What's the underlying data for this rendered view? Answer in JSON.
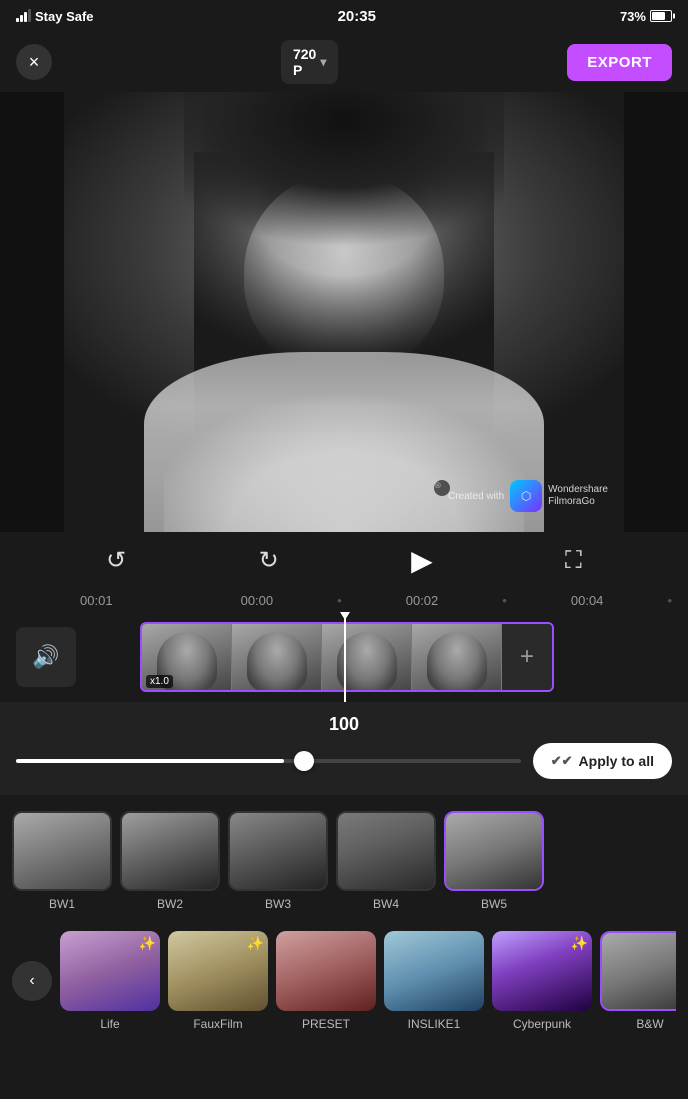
{
  "statusBar": {
    "carrier": "Stay Safe",
    "time": "20:35",
    "battery": "73%"
  },
  "toolbar": {
    "closeLabel": "×",
    "quality": "720\nP",
    "qualityDropdown": "▾",
    "exportLabel": "EXPORT"
  },
  "videoPreview": {
    "watermark": {
      "closeLabel": "×",
      "createdWith": "Created with",
      "appName": "Wondershare\nFilmoraGo"
    },
    "expandLabel": "⛶"
  },
  "playbackControls": {
    "undoIcon": "↺",
    "redoIcon": "↻",
    "playIcon": "▶",
    "fullscreenIcon": "⛶"
  },
  "timelineRuler": {
    "marks": [
      "00:01",
      "00:00",
      "•",
      "00:02",
      "•",
      "00:04",
      "•"
    ]
  },
  "timeline": {
    "audioIcon": "🔊",
    "speedBadge": "x1.0",
    "addClipIcon": "+"
  },
  "intensityPanel": {
    "value": "100",
    "sliderPercent": 53,
    "applyAllIcon": "✔✔",
    "applyAllLabel": "Apply to all"
  },
  "filters": {
    "row1": [
      {
        "label": "BW1",
        "colorClass": "bw1",
        "selected": false
      },
      {
        "label": "BW2",
        "colorClass": "bw2",
        "selected": false
      },
      {
        "label": "BW3",
        "colorClass": "bw3",
        "selected": false
      },
      {
        "label": "BW4",
        "colorClass": "bw4",
        "selected": false
      },
      {
        "label": "BW5",
        "colorClass": "bw5",
        "selected": true
      }
    ],
    "row2": [
      {
        "label": "Life",
        "colorClass": "life-f",
        "sparkle": true
      },
      {
        "label": "FauxFilm",
        "colorClass": "faux-f",
        "sparkle": true
      },
      {
        "label": "PRESET",
        "colorClass": "preset-f",
        "sparkle": false
      },
      {
        "label": "INSLIKE1",
        "colorClass": "inslike-f",
        "sparkle": false
      },
      {
        "label": "Cyberpunk",
        "colorClass": "cyber-f",
        "sparkle": true
      },
      {
        "label": "B&W",
        "colorClass": "bwcat-f",
        "sparkle": true
      }
    ]
  }
}
